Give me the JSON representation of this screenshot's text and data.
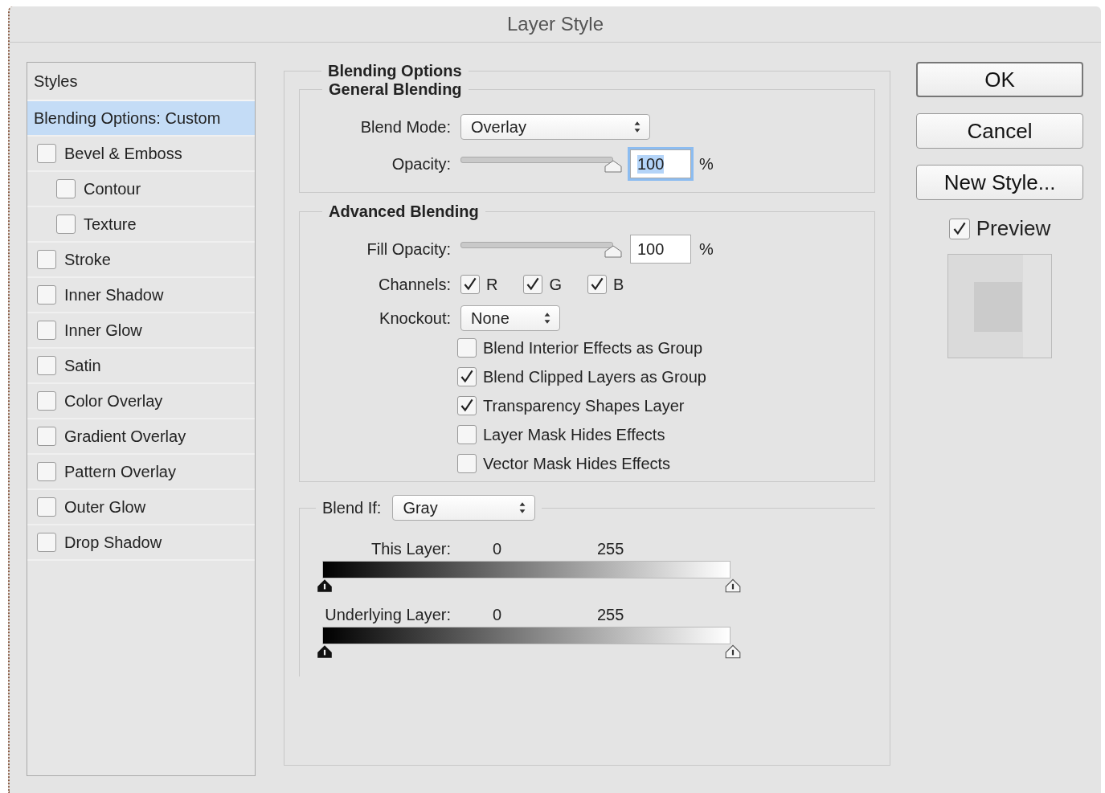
{
  "window": {
    "title": "Layer Style"
  },
  "styles_panel": {
    "heading": "Styles",
    "items": [
      {
        "label": "Blending Options: Custom",
        "kind": "plain",
        "selected": true
      },
      {
        "label": "Bevel & Emboss",
        "kind": "check",
        "checked": false,
        "selected": false,
        "children": [
          {
            "label": "Contour",
            "kind": "check",
            "checked": false,
            "selected": false
          },
          {
            "label": "Texture",
            "kind": "check",
            "checked": false,
            "selected": false
          }
        ]
      },
      {
        "label": "Stroke",
        "kind": "check",
        "checked": false,
        "selected": false
      },
      {
        "label": "Inner Shadow",
        "kind": "check",
        "checked": false,
        "selected": false
      },
      {
        "label": "Inner Glow",
        "kind": "check",
        "checked": false,
        "selected": false
      },
      {
        "label": "Satin",
        "kind": "check",
        "checked": false,
        "selected": false
      },
      {
        "label": "Color Overlay",
        "kind": "check",
        "checked": false,
        "selected": false
      },
      {
        "label": "Gradient Overlay",
        "kind": "check",
        "checked": false,
        "selected": false
      },
      {
        "label": "Pattern Overlay",
        "kind": "check",
        "checked": false,
        "selected": false
      },
      {
        "label": "Outer Glow",
        "kind": "check",
        "checked": false,
        "selected": false
      },
      {
        "label": "Drop Shadow",
        "kind": "check",
        "checked": false,
        "selected": false
      }
    ]
  },
  "blending_options": {
    "title": "Blending Options",
    "general": {
      "title": "General Blending",
      "blend_mode": {
        "label": "Blend Mode:",
        "value": "Overlay"
      },
      "opacity": {
        "label": "Opacity:",
        "level": 1,
        "value": "100",
        "unit": "%",
        "focused": true
      }
    },
    "advanced": {
      "title": "Advanced Blending",
      "fill_opacity": {
        "label": "Fill Opacity:",
        "level": 1,
        "value": "100",
        "unit": "%",
        "focused": false
      },
      "channels": {
        "label": "Channels:",
        "items": [
          {
            "label": "R",
            "checked": true
          },
          {
            "label": "G",
            "checked": true
          },
          {
            "label": "B",
            "checked": true
          }
        ]
      },
      "knockout": {
        "label": "Knockout:",
        "value": "None"
      },
      "options": [
        {
          "label": "Blend Interior Effects as Group",
          "checked": false
        },
        {
          "label": "Blend Clipped Layers as Group",
          "checked": true
        },
        {
          "label": "Transparency Shapes Layer",
          "checked": true
        },
        {
          "label": "Layer Mask Hides Effects",
          "checked": false
        },
        {
          "label": "Vector Mask Hides Effects",
          "checked": false
        }
      ]
    },
    "blend_if": {
      "label": "Blend If:",
      "value": "Gray",
      "ranges": [
        {
          "label": "This Layer:",
          "low": "0",
          "high": "255"
        },
        {
          "label": "Underlying Layer:",
          "low": "0",
          "high": "255"
        }
      ]
    }
  },
  "buttons": [
    {
      "label": "OK",
      "kind": "default"
    },
    {
      "label": "Cancel",
      "kind": "normal"
    },
    {
      "label": "New Style...",
      "kind": "normal"
    }
  ],
  "preview": {
    "label": "Preview",
    "checked": true
  }
}
